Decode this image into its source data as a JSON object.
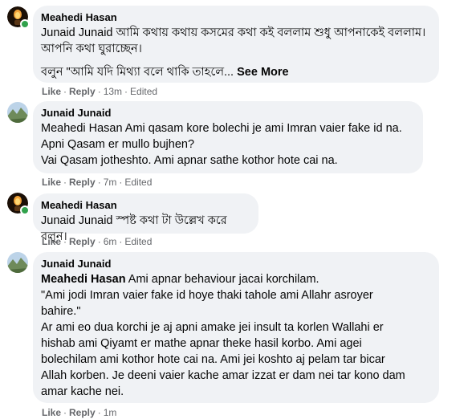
{
  "comments": [
    {
      "author": "Meahedi Hasan",
      "lines": [
        "Junaid Junaid আমি কথায় কথায় কসমের কথা কই বললাম শুধু আপনাকেই বললাম।",
        "আপনি কথা ঘুরাচ্ছেন।",
        "বলুন \"আমি যদি মিথ্যা বলে থাকি তাহলে..."
      ],
      "see_more": "See More",
      "like": "Like",
      "reply": "Reply",
      "time": "13m",
      "edited": "Edited"
    },
    {
      "author": "Junaid Junaid",
      "lines": [
        "Meahedi Hasan Ami qasam kore bolechi je ami Imran vaier fake id na.",
        "Apni Qasam er mullo bujhen?",
        "Vai Qasam jotheshto. Ami apnar sathe kothor hote cai na."
      ],
      "like": "Like",
      "reply": "Reply",
      "time": "7m",
      "edited": "Edited"
    },
    {
      "author": "Meahedi Hasan",
      "lines": [
        "Junaid Junaid স্পষ্ট কথা টা উল্লেখ করে বলুন।"
      ],
      "like": "Like",
      "reply": "Reply",
      "time": "6m",
      "edited": "Edited"
    },
    {
      "author": "Junaid Junaid",
      "mention": "Meahedi Hasan",
      "lines": [
        " Ami apnar behaviour jacai korchilam.",
        "\"Ami jodi Imran vaier fake id hoye thaki tahole ami Allahr asroyer",
        "bahire.\"",
        "Ar ami eo dua korchi je aj apni amake jei insult ta korlen Wallahi er",
        "hishab ami Qiyamt er mathe apnar theke hasil korbo. Ami agei",
        "bolechilam ami kothor hote cai na. Ami jei koshto aj pelam tar bicar",
        "Allah korben. Je deeni vaier kache amar izzat er dam nei tar kono dam",
        "amar kache nei."
      ],
      "like": "Like",
      "reply": "Reply",
      "time": "1m"
    }
  ],
  "separator": "·"
}
